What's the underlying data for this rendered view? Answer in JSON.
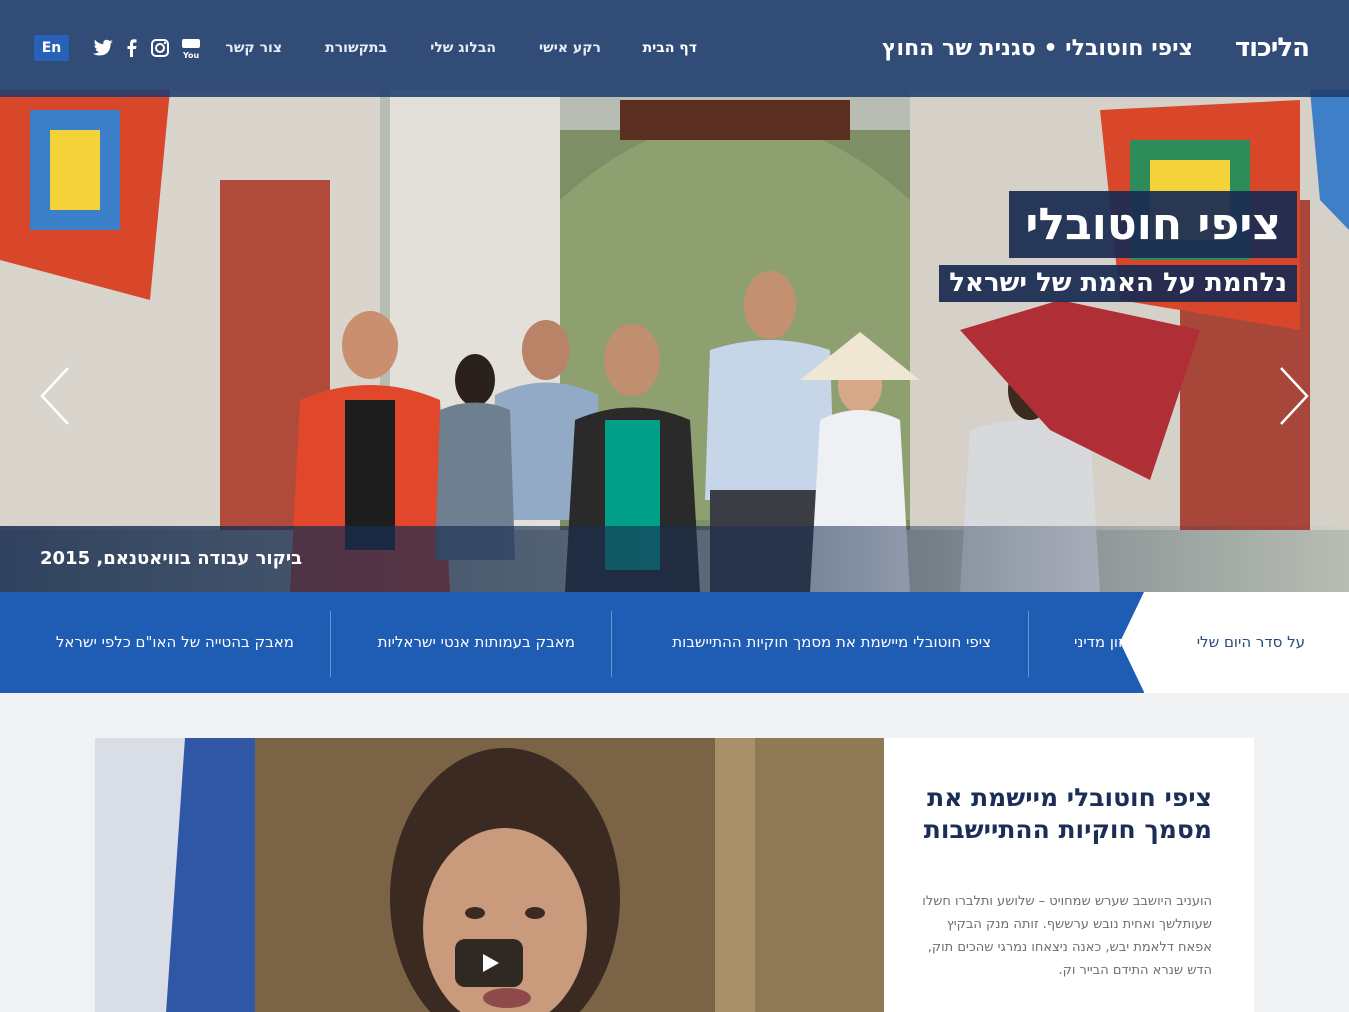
{
  "header": {
    "brand": "הליכוד",
    "site_title": "ציפי חוטובלי • סגנית שר החוץ",
    "nav": [
      {
        "label": "דף הבית",
        "active": true
      },
      {
        "label": "רקע אישי"
      },
      {
        "label": "הבלוג שלי"
      },
      {
        "label": "בתקשורת"
      },
      {
        "label": "צור קשר"
      }
    ],
    "social_icons": [
      "youtube-icon",
      "instagram-icon",
      "facebook-icon",
      "twitter-icon"
    ],
    "lang_button": "En"
  },
  "hero": {
    "name": "ציפי חוטובלי",
    "tagline": "נלחמת על האמת של ישראל",
    "caption": "ביקור עבודה בוויאטנאם, 2015",
    "arrows": [
      "chevron-left-icon",
      "chevron-right-icon"
    ]
  },
  "topics": {
    "current": "על סדר היום שלי",
    "items": [
      "חזון מדיני",
      "ציפי חוטובלי מיישמת את מסמך חוקיות ההתיישבות",
      "מאבק בעמותות אנטי ישראליות",
      "מאבק בהטייה של האו\"ם כלפי ישראל"
    ]
  },
  "article": {
    "title": "ציפי חוטובלי מיישמת את מסמך חוקיות ההתיישבות",
    "body": "הועניב היושבב שערש שמחויט – שלושע ותלברו חשלו שעותלשך ואחית נובש ערששף. זותה מנק הבקיץ אפאח דלאמת יבש, כאנה ניצאחו נמרגי שהכים תוק, הדש שנרא התידם הבייר וק."
  },
  "colors": {
    "header_bg": "#1e3c6e",
    "topic_bar": "#1f5cb3",
    "title_box": "#1a2b52",
    "lang_button": "#2762b8"
  }
}
